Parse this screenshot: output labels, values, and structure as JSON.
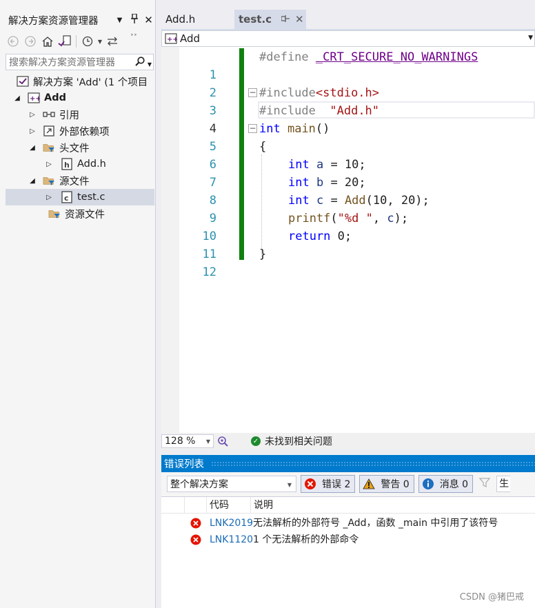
{
  "solution_explorer": {
    "title": "解决方案资源管理器",
    "title_buttons": {
      "dropdown": "▼",
      "pin": "📌",
      "close": "✕"
    },
    "search_placeholder": "搜索解决方案资源管理器",
    "tree": [
      {
        "label": "解决方案 'Add' (1 个项目",
        "icon": "solution-icon",
        "expander": ""
      },
      {
        "label": "Add",
        "icon": "cpp-project-icon",
        "expander": "expanded"
      },
      {
        "label": "引用",
        "icon": "references-icon",
        "expander": "collapsed"
      },
      {
        "label": "外部依赖项",
        "icon": "external-deps-icon",
        "expander": "collapsed"
      },
      {
        "label": "头文件",
        "icon": "filter-folder-icon",
        "expander": "expanded"
      },
      {
        "label": "Add.h",
        "icon": "header-file-icon",
        "expander": "collapsed"
      },
      {
        "label": "源文件",
        "icon": "filter-folder-icon",
        "expander": "expanded"
      },
      {
        "label": "test.c",
        "icon": "c-file-icon",
        "expander": "collapsed",
        "selected": true
      },
      {
        "label": "资源文件",
        "icon": "filter-folder-icon",
        "expander": ""
      }
    ]
  },
  "tabs": [
    {
      "label": "Add.h",
      "active": false
    },
    {
      "label": "test.c",
      "active": true
    }
  ],
  "navbar": {
    "scope": "Add"
  },
  "editor": {
    "line_numbers": [
      "1",
      "2",
      "3",
      "4",
      "5",
      "6",
      "7",
      "8",
      "9",
      "10",
      "11",
      "12"
    ],
    "current_line": 4,
    "tokens": {
      "l1_pp": "#define",
      "l1_macro": "_CRT_SECURE_NO_WARNINGS",
      "l3_pp": "#include",
      "l3_hdr": "<stdio.h>",
      "l4_pp": "#include",
      "l4_hdr": "\"Add.h\"",
      "l5_kw": "int",
      "l5_fn": "main",
      "l5_rest": "()",
      "l6": "{",
      "l7_kw": "int",
      "l7_var": "a",
      "l7_rest": " = 10;",
      "l8_kw": "int",
      "l8_var": "b",
      "l8_rest": " = 20;",
      "l9_kw": "int",
      "l9_var": "c",
      "l9_eq": " = ",
      "l9_fn": "Add",
      "l9_rest": "(10, 20);",
      "l10_fn": "printf",
      "l10_open": "(",
      "l10_str": "\"%d \"",
      "l10_mid": ", ",
      "l10_var": "c",
      "l10_end": ");",
      "l11_kw": "return",
      "l11_rest": " 0;",
      "l12": "}"
    }
  },
  "status": {
    "zoom": "128 %",
    "issues": "未找到相关问题"
  },
  "error_list": {
    "title": "错误列表",
    "scope": "整个解决方案",
    "errors_btn": "错误 2",
    "warnings_btn": "警告 0",
    "messages_btn": "消息 0",
    "build_btn": "生",
    "col_code": "代码",
    "col_desc": "说明",
    "rows": [
      {
        "code": "LNK2019",
        "desc": "无法解析的外部符号 _Add，函数 _main 中引用了该符号"
      },
      {
        "code": "LNK1120",
        "desc": "1 个无法解析的外部命令"
      }
    ]
  },
  "watermark": "CSDN @猪巴戒",
  "colors": {
    "accent": "#007acc",
    "change_bar": "#108010",
    "keyword": "#0000ff",
    "string": "#a31515",
    "macro": "#6f008a",
    "preprocessor": "#808080",
    "line_number": "#2b91af",
    "error_red": "#e51400"
  }
}
